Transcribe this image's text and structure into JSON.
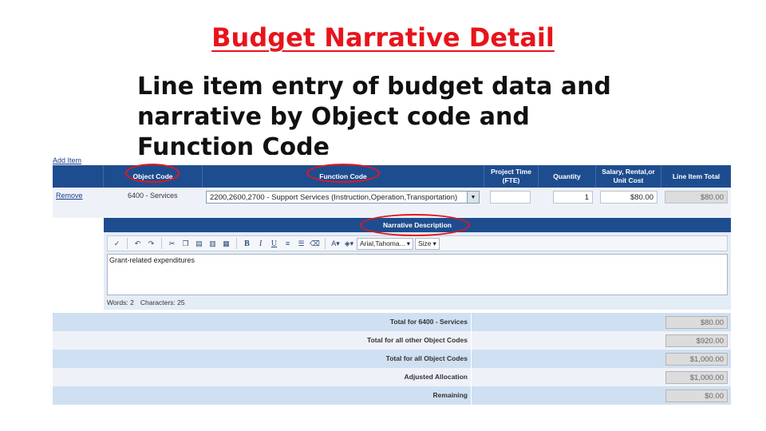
{
  "slide": {
    "title": "Budget Narrative Detail",
    "subtitle": "Line item entry of budget data and narrative by Object code and Function Code"
  },
  "links": {
    "add_item": "Add Item",
    "remove": "Remove"
  },
  "headers": {
    "object_code": "Object Code",
    "function_code": "Function Code",
    "project_time": "Project Time (FTE)",
    "quantity": "Quantity",
    "salary": "Salary, Rental,or Unit Cost",
    "line_total": "Line Item Total"
  },
  "row": {
    "object_code": "6400 - Services",
    "function_code": "2200,2600,2700 - Support Services (Instruction,Operation,Transportation)",
    "project_time": "",
    "quantity": "1",
    "salary": "$80.00",
    "line_total": "$80.00"
  },
  "narrative": {
    "header": "Narrative Description",
    "text": "Grant-related expenditures",
    "words": "Words: 2",
    "characters": "Characters: 25",
    "font_select": "Arial,Tahoma...",
    "size_select": "Size"
  },
  "totals": [
    {
      "label": "Total for 6400 - Services",
      "value": "$80.00"
    },
    {
      "label": "Total for all other Object Codes",
      "value": "$920.00"
    },
    {
      "label": "Total for all Object Codes",
      "value": "$1,000.00"
    },
    {
      "label": "Adjusted Allocation",
      "value": "$1,000.00"
    },
    {
      "label": "Remaining",
      "value": "$0.00"
    }
  ],
  "colors": {
    "header_bg": "#1e4d8f",
    "title_red": "#e8141b",
    "row_alt": "#cfe0f2"
  }
}
